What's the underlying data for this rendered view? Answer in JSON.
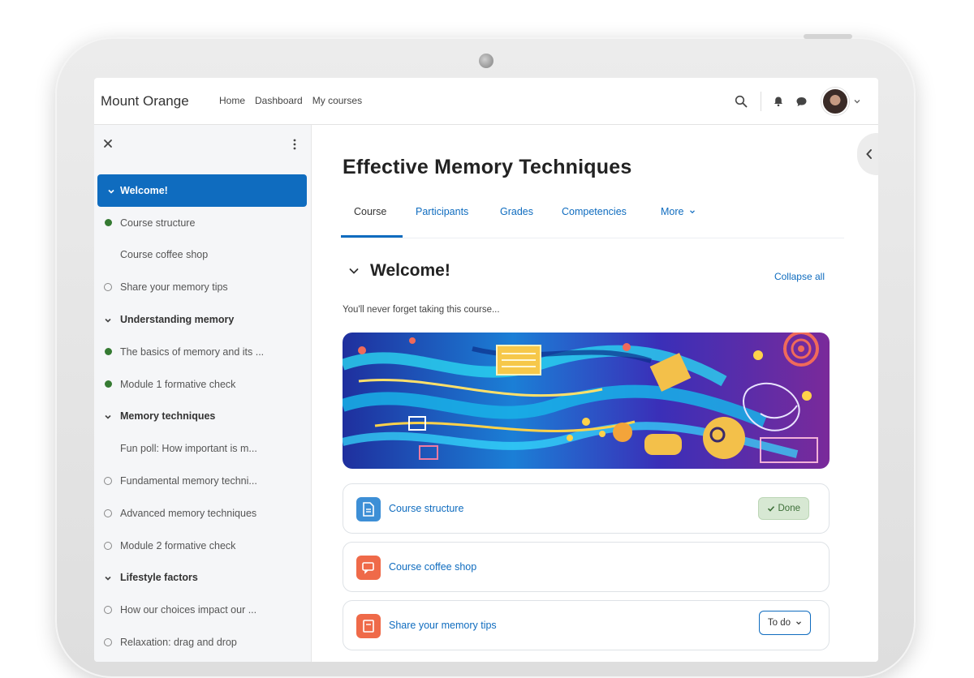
{
  "brand": "Mount Orange",
  "nav": {
    "links": [
      "Home",
      "Dashboard",
      "My courses"
    ]
  },
  "course_index": {
    "items": [
      {
        "label": "Welcome!",
        "kind": "section",
        "active": true,
        "state": ""
      },
      {
        "label": "Course structure",
        "kind": "activity",
        "state": "done"
      },
      {
        "label": "Course coffee shop",
        "kind": "activity",
        "state": "none"
      },
      {
        "label": "Share your memory tips",
        "kind": "activity",
        "state": "todo"
      },
      {
        "label": "Understanding memory",
        "kind": "section",
        "state": ""
      },
      {
        "label": "The basics of memory and its ...",
        "kind": "activity",
        "state": "done"
      },
      {
        "label": "Module 1 formative check",
        "kind": "activity",
        "state": "done"
      },
      {
        "label": "Memory techniques",
        "kind": "section",
        "state": ""
      },
      {
        "label": "Fun poll: How important is m...",
        "kind": "activity",
        "state": "none"
      },
      {
        "label": "Fundamental memory techni...",
        "kind": "activity",
        "state": "todo"
      },
      {
        "label": "Advanced memory techniques",
        "kind": "activity",
        "state": "todo"
      },
      {
        "label": "Module 2 formative check",
        "kind": "activity",
        "state": "todo"
      },
      {
        "label": "Lifestyle factors",
        "kind": "section",
        "state": ""
      },
      {
        "label": "How our choices impact our ...",
        "kind": "activity",
        "state": "todo"
      },
      {
        "label": "Relaxation: drag and drop",
        "kind": "activity",
        "state": "todo"
      }
    ]
  },
  "course": {
    "title": "Effective Memory Techniques",
    "tabs": [
      "Course",
      "Participants",
      "Grades",
      "Competencies",
      "More"
    ],
    "section_title": "Welcome!",
    "collapse_all": "Collapse all",
    "summary": "You'll never forget taking this course...",
    "activities": [
      {
        "name": "Course structure",
        "icon": "page-icon",
        "icon_color": "#3d8fd6",
        "status": "Done"
      },
      {
        "name": "Course coffee shop",
        "icon": "forum-icon",
        "icon_color": "#ef6a49",
        "status": ""
      },
      {
        "name": "Share your memory tips",
        "icon": "assignment-icon",
        "icon_color": "#ef6a49",
        "status": "To do"
      }
    ]
  },
  "colors": {
    "primary": "#0f6cbf",
    "done_bg": "#d7e8d3",
    "done_dot": "#357a32"
  }
}
